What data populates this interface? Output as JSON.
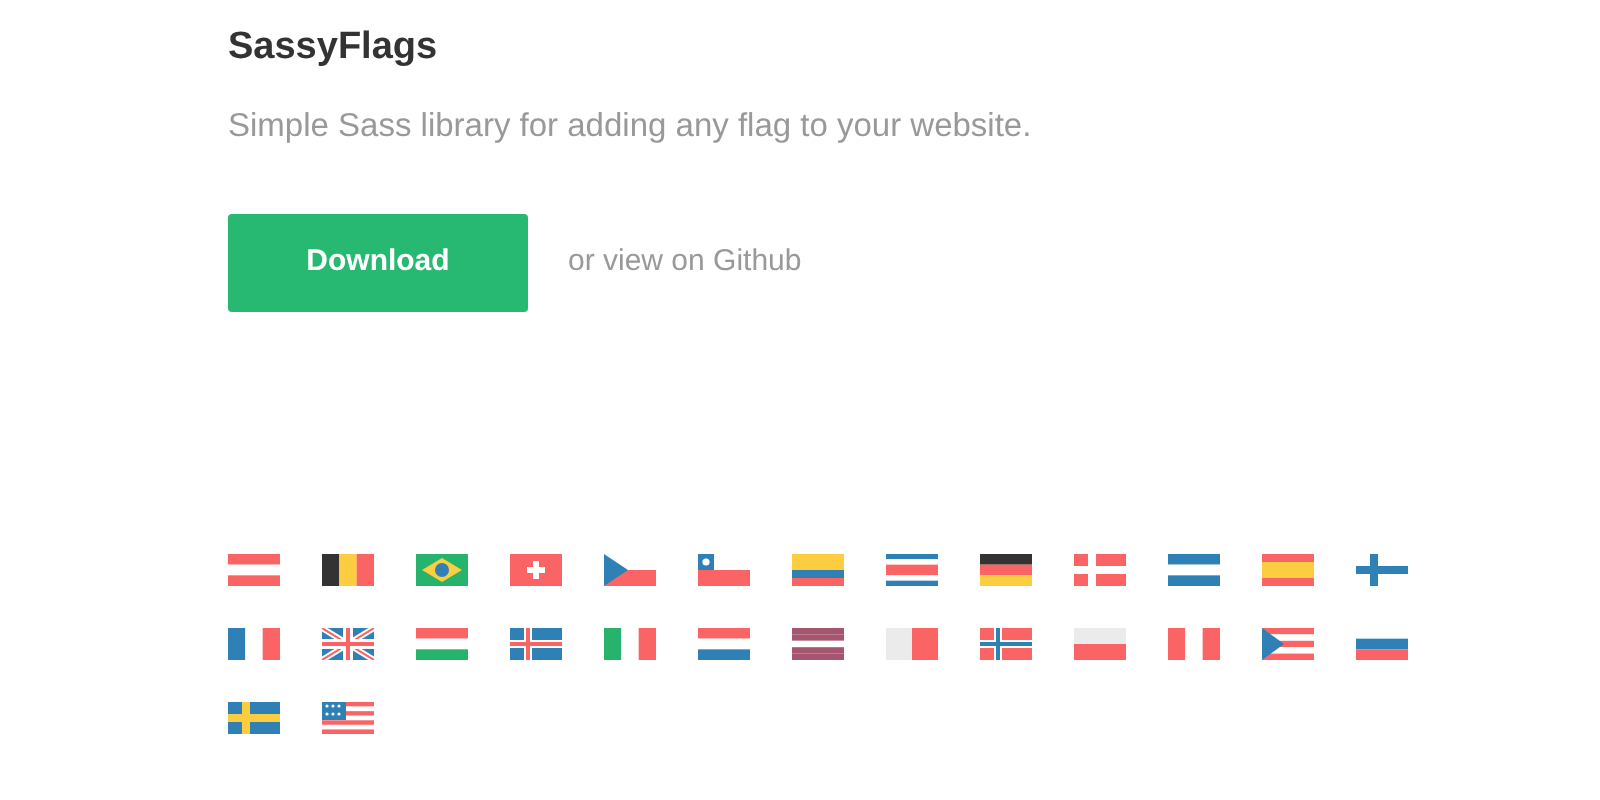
{
  "title": "SassyFlags",
  "subtitle": "Simple Sass library for adding any flag to your website.",
  "download_button": "Download",
  "github_link": "or view on Github",
  "flags": [
    {
      "kind": "austria"
    },
    {
      "kind": "belgium"
    },
    {
      "kind": "brazil"
    },
    {
      "kind": "switzerland"
    },
    {
      "kind": "czech"
    },
    {
      "kind": "chile"
    },
    {
      "kind": "colombia"
    },
    {
      "kind": "costarica"
    },
    {
      "kind": "germany"
    },
    {
      "kind": "denmark"
    },
    {
      "kind": "honduras"
    },
    {
      "kind": "spain"
    },
    {
      "kind": "finland"
    },
    {
      "kind": "france"
    },
    {
      "kind": "uk"
    },
    {
      "kind": "hungary"
    },
    {
      "kind": "iceland"
    },
    {
      "kind": "italy"
    },
    {
      "kind": "netherlands"
    },
    {
      "kind": "latvia"
    },
    {
      "kind": "malta"
    },
    {
      "kind": "norway"
    },
    {
      "kind": "poland"
    },
    {
      "kind": "peru"
    },
    {
      "kind": "puertorico"
    },
    {
      "kind": "russia"
    },
    {
      "kind": "sweden"
    },
    {
      "kind": "usa"
    }
  ]
}
